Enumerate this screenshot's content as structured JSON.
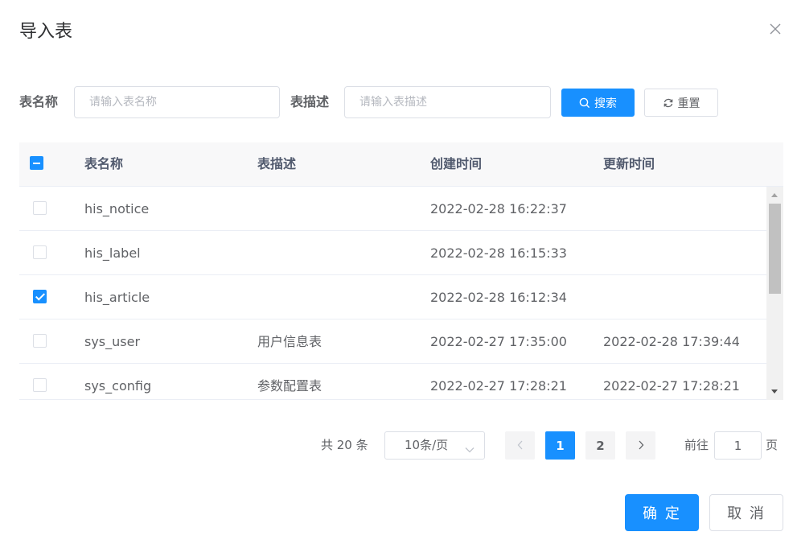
{
  "dialog": {
    "title": "导入表",
    "close_icon": "close-icon"
  },
  "search": {
    "name_label": "表名称",
    "name_placeholder": "请输入表名称",
    "name_value": "",
    "desc_label": "表描述",
    "desc_placeholder": "请输入表描述",
    "desc_value": "",
    "search_label": "搜索",
    "search_icon": "search-icon",
    "reset_label": "重置",
    "reset_icon": "refresh-icon"
  },
  "table": {
    "select_all_state": "indeterminate",
    "columns": [
      "表名称",
      "表描述",
      "创建时间",
      "更新时间"
    ],
    "rows": [
      {
        "checked": false,
        "name": "his_notice",
        "desc": "",
        "created": "2022-02-28 16:22:37",
        "updated": ""
      },
      {
        "checked": false,
        "name": "his_label",
        "desc": "",
        "created": "2022-02-28 16:15:33",
        "updated": ""
      },
      {
        "checked": true,
        "name": "his_article",
        "desc": "",
        "created": "2022-02-28 16:12:34",
        "updated": ""
      },
      {
        "checked": false,
        "name": "sys_user",
        "desc": "用户信息表",
        "created": "2022-02-27 17:35:00",
        "updated": "2022-02-28 17:39:44"
      },
      {
        "checked": false,
        "name": "sys_config",
        "desc": "参数配置表",
        "created": "2022-02-27 17:28:21",
        "updated": "2022-02-27 17:28:21"
      }
    ]
  },
  "pagination": {
    "total_text": "共 20 条",
    "page_size_label": "10条/页",
    "pages": [
      "1",
      "2"
    ],
    "current_page": "1",
    "goto_label": "前往",
    "goto_value": "1",
    "goto_suffix": "页"
  },
  "footer": {
    "confirm_label": "确 定",
    "cancel_label": "取 消"
  },
  "colors": {
    "primary": "#1890ff",
    "border": "#dcdfe6",
    "header_bg": "#f8f8f9",
    "text": "#606266"
  }
}
